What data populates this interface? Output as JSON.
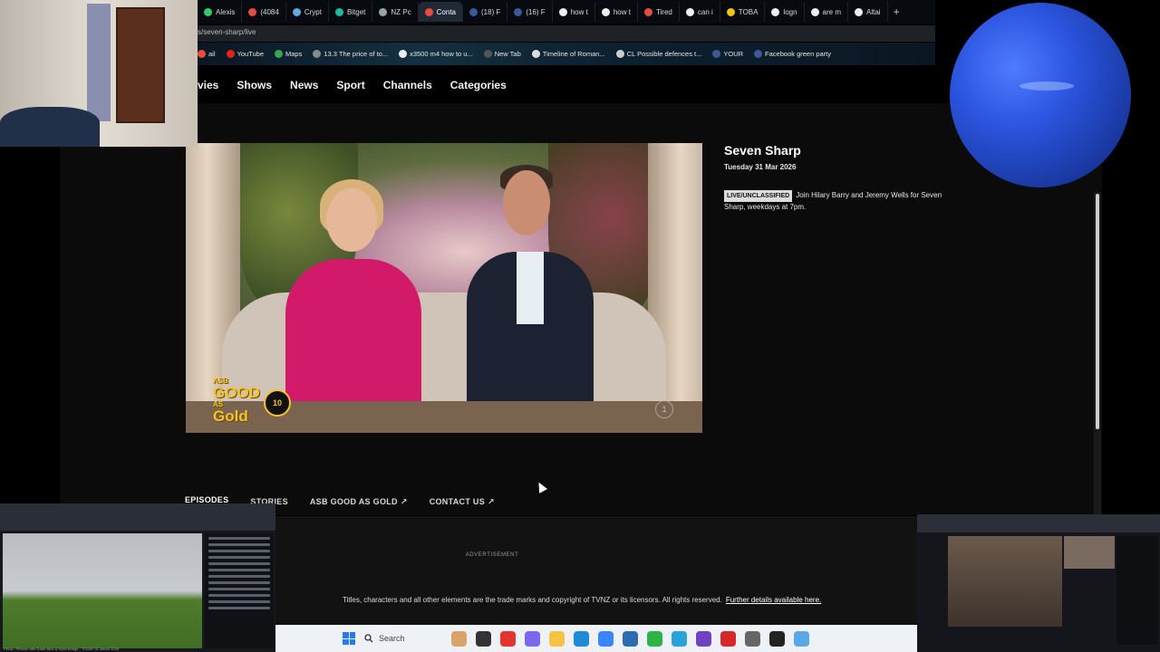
{
  "browser": {
    "tabs": [
      {
        "label": "Alexis",
        "color": "#2ecc71"
      },
      {
        "label": "(4084",
        "color": "#e74c3c"
      },
      {
        "label": "Crypt",
        "color": "#5dade2"
      },
      {
        "label": "Bitget",
        "color": "#1abc9c"
      },
      {
        "label": "NZ Pc",
        "color": "#95a5a6"
      },
      {
        "label": "Conta",
        "color": "#e74c3c"
      },
      {
        "label": "(18) F",
        "color": "#3b5998"
      },
      {
        "label": "(16) F",
        "color": "#3b5998"
      },
      {
        "label": "how t",
        "color": "#eeeeee"
      },
      {
        "label": "how t",
        "color": "#eeeeee"
      },
      {
        "label": "Tired",
        "color": "#e74c3c"
      },
      {
        "label": "can i",
        "color": "#eeeeee"
      },
      {
        "label": "TOBA",
        "color": "#f1c40f"
      },
      {
        "label": "logn",
        "color": "#eeeeee"
      },
      {
        "label": "are m",
        "color": "#eeeeee"
      },
      {
        "label": "Altai",
        "color": "#eeeeee"
      }
    ],
    "active_tab_index": 5,
    "new_tab": "+",
    "url": "s/seven-sharp/live",
    "bookmarks": [
      {
        "label": "ail",
        "color": "#e74c3c"
      },
      {
        "label": "YouTube",
        "color": "#e62117"
      },
      {
        "label": "Maps",
        "color": "#34a853"
      },
      {
        "label": "13.3 The price of to...",
        "color": "#7f8c8d"
      },
      {
        "label": "x3500 m4 how to u...",
        "color": "#eeeeee"
      },
      {
        "label": "New Tab",
        "color": "#555555"
      },
      {
        "label": "Timeline of Roman...",
        "color": "#dddddd"
      },
      {
        "label": "CL Possible defences t...",
        "color": "#cccccc"
      },
      {
        "label": "YOUR",
        "color": "#3b5998"
      },
      {
        "label": "Facebook green party",
        "color": "#3b5998"
      }
    ]
  },
  "site": {
    "nav": [
      "vies",
      "Shows",
      "News",
      "Sport",
      "Channels",
      "Categories"
    ]
  },
  "video": {
    "overlay_brand": "ASB",
    "overlay_line1": "GOOD",
    "overlay_line2": "AS",
    "overlay_line3": "Gold",
    "overlay_badge": "10",
    "rating": "1"
  },
  "show": {
    "title": "Seven Sharp",
    "date": "Tuesday 31 Mar 2026",
    "badge": "LIVE/UNCLASSIFIED",
    "description": "Join Hilary Barry and Jeremy Wells for Seven Sharp, weekdays at 7pm."
  },
  "subtabs": [
    {
      "label": "EPISODES",
      "active": true,
      "external": false
    },
    {
      "label": "STORIES",
      "active": false,
      "external": false
    },
    {
      "label": "ASB GOOD AS GOLD",
      "active": false,
      "external": true
    },
    {
      "label": "CONTACT US",
      "active": false,
      "external": true
    }
  ],
  "footer": {
    "ad_label": "ADVERTISEMENT",
    "copyright": "Titles, characters and all other elements are the trade marks and copyright of TVNZ or its licensors. All rights reserved.",
    "link": "Further details available here."
  },
  "taskbar": {
    "search_placeholder": "Search",
    "icons": [
      {
        "name": "widgets-icon",
        "color": "#d9a46a"
      },
      {
        "name": "task-view-icon",
        "color": "#333333"
      },
      {
        "name": "chrome-icon",
        "color": "#e3342f"
      },
      {
        "name": "copilot-icon",
        "color": "#7b68ee"
      },
      {
        "name": "file-explorer-icon",
        "color": "#f4c542"
      },
      {
        "name": "edge-icon",
        "color": "#1f8ad6"
      },
      {
        "name": "app-icon",
        "color": "#3a86ff"
      },
      {
        "name": "store-icon",
        "color": "#2b6cb0"
      },
      {
        "name": "green-app-icon",
        "color": "#2fb344"
      },
      {
        "name": "telegram-icon",
        "color": "#2aa3db"
      },
      {
        "name": "purple-app-icon",
        "color": "#6f42c1"
      },
      {
        "name": "red-app-icon",
        "color": "#d62828"
      },
      {
        "name": "settings-icon",
        "color": "#666666"
      },
      {
        "name": "obs-icon",
        "color": "#222222"
      },
      {
        "name": "photos-icon",
        "color": "#5aa9e6"
      }
    ]
  },
  "overlays": {
    "left_pip_caption": "FINAL: Presser with Darth Blue & Ryan Bridge - TODAY 31 March 2026"
  }
}
